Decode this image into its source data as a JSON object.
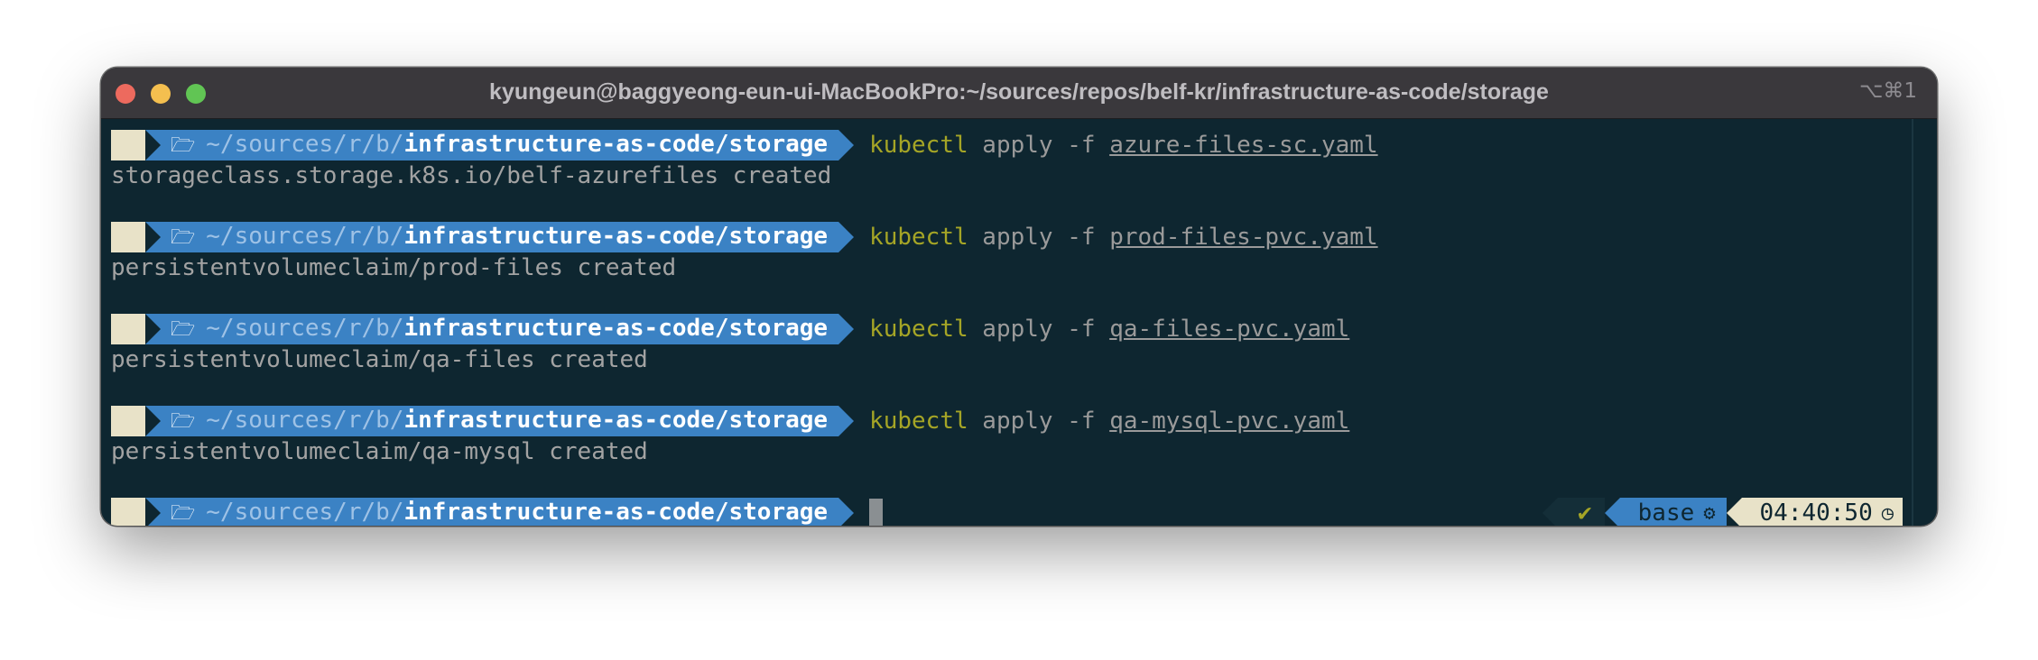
{
  "window": {
    "title": "kyungeun@baggyeong-eun-ui-MacBookPro:~/sources/repos/belf-kr/infrastructure-as-code/storage",
    "shortcut": "⌥⌘1"
  },
  "prompt": {
    "os_icon": "apple-icon",
    "folder_icon": "folder-icon",
    "path_home": "~/sources/",
    "path_r": "r",
    "path_sep": "/",
    "path_b": "b",
    "path_sep2": "/",
    "path_bold": "infrastructure-as-code/storage"
  },
  "entries": [
    {
      "command": "kubectl",
      "args": " apply -f ",
      "file": "azure-files-sc.yaml",
      "output": "storageclass.storage.k8s.io/belf-azurefiles created"
    },
    {
      "command": "kubectl",
      "args": " apply -f ",
      "file": "prod-files-pvc.yaml",
      "output": "persistentvolumeclaim/prod-files created"
    },
    {
      "command": "kubectl",
      "args": " apply -f ",
      "file": "qa-files-pvc.yaml",
      "output": "persistentvolumeclaim/qa-files created"
    },
    {
      "command": "kubectl",
      "args": " apply -f ",
      "file": "qa-mysql-pvc.yaml",
      "output": "persistentvolumeclaim/qa-mysql created"
    }
  ],
  "right_prompt": {
    "status": "✔",
    "env": "base",
    "env_icon": "python-icon",
    "time": "04:40:50",
    "time_icon": "clock-icon"
  },
  "colors": {
    "background": "#0e2630",
    "path_segment": "#3b82c4",
    "os_segment": "#e8e2c8",
    "command": "#a5a526"
  }
}
